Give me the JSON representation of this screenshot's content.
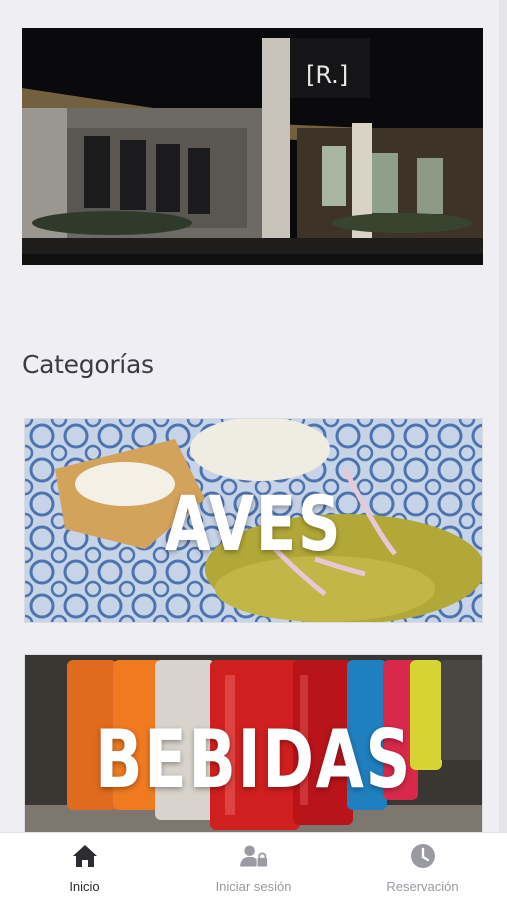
{
  "hero": {
    "icon": "restaurant-photo",
    "sign_text": "[R.]"
  },
  "categories_title": "Categorías",
  "categories": [
    {
      "label": "AVES",
      "image": "mole-dish-photo"
    },
    {
      "label": "BEBIDAS",
      "image": "soda-cans-photo"
    }
  ],
  "bottom_nav": {
    "items": [
      {
        "label": "Inicio",
        "icon": "home-icon",
        "active": true
      },
      {
        "label": "Iniciar sesión",
        "icon": "user-lock-icon",
        "active": false
      },
      {
        "label": "Reservación",
        "icon": "clock-icon",
        "active": false
      }
    ]
  },
  "colors": {
    "active_nav": "#2c2c33",
    "inactive_nav": "#9a9aa2",
    "background": "#efeef3"
  }
}
